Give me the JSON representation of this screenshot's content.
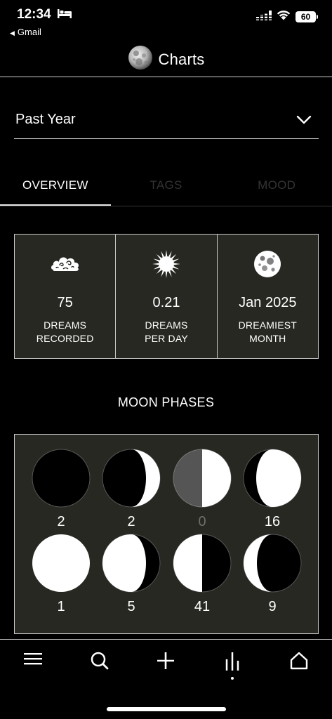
{
  "status_bar": {
    "time": "12:34",
    "back_app": "Gmail",
    "battery": "60"
  },
  "header": {
    "title": "Charts"
  },
  "range": {
    "selected": "Past Year"
  },
  "tabs": [
    {
      "label": "OVERVIEW",
      "active": true
    },
    {
      "label": "TAGS",
      "active": false
    },
    {
      "label": "MOOD",
      "active": false
    }
  ],
  "stats": [
    {
      "icon": "cloud-icon",
      "value": "75",
      "label_line1": "DREAMS",
      "label_line2": "RECORDED"
    },
    {
      "icon": "sun-icon",
      "value": "0.21",
      "label_line1": "DREAMS",
      "label_line2": "PER DAY"
    },
    {
      "icon": "moon-icon",
      "value": "Jan 2025",
      "label_line1": "DREAMIEST",
      "label_line2": "MONTH"
    }
  ],
  "moon_phases": {
    "title": "MOON PHASES",
    "items": [
      {
        "phase": "new-moon",
        "count": "2"
      },
      {
        "phase": "waxing-crescent",
        "count": "2"
      },
      {
        "phase": "first-quarter",
        "count": "0"
      },
      {
        "phase": "waxing-gibbous",
        "count": "16"
      },
      {
        "phase": "full-moon",
        "count": "1"
      },
      {
        "phase": "waning-gibbous",
        "count": "5"
      },
      {
        "phase": "last-quarter",
        "count": "41"
      },
      {
        "phase": "waning-crescent",
        "count": "9"
      }
    ]
  },
  "bottom_nav": [
    "menu-icon",
    "search-icon",
    "add-icon",
    "charts-icon",
    "home-icon"
  ],
  "colors": {
    "background": "#000000",
    "panel": "#272822",
    "border": "#c8c8c8",
    "inactive_tab": "#333333",
    "dim_count": "#6e6e6e"
  }
}
